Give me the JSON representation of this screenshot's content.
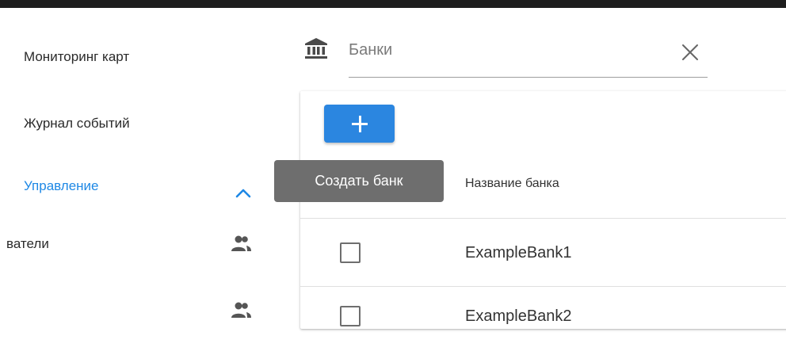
{
  "sidebar": {
    "items": [
      {
        "label": "Мониторинг карт"
      },
      {
        "label": "Журнал событий"
      },
      {
        "label": "Управление"
      }
    ],
    "sub_items": [
      {
        "label": "ватели"
      },
      {
        "label": ""
      }
    ]
  },
  "search": {
    "placeholder": "Банки",
    "value": ""
  },
  "toolbar": {
    "tooltip": "Создать банк"
  },
  "table": {
    "columns": [
      "Название банка"
    ],
    "rows": [
      {
        "name": "ExampleBank1"
      },
      {
        "name": "ExampleBank2"
      }
    ]
  },
  "colors": {
    "accent": "#1e88e5",
    "button": "#2b86e0",
    "tooltip_bg": "#6e6e6e",
    "topbar": "#1e1e1e"
  },
  "icons": {
    "search_prefix": "bank-icon",
    "clear": "close-icon",
    "expand": "chevron-up-icon",
    "sub_item": "people-icon",
    "add": "plus-icon"
  }
}
